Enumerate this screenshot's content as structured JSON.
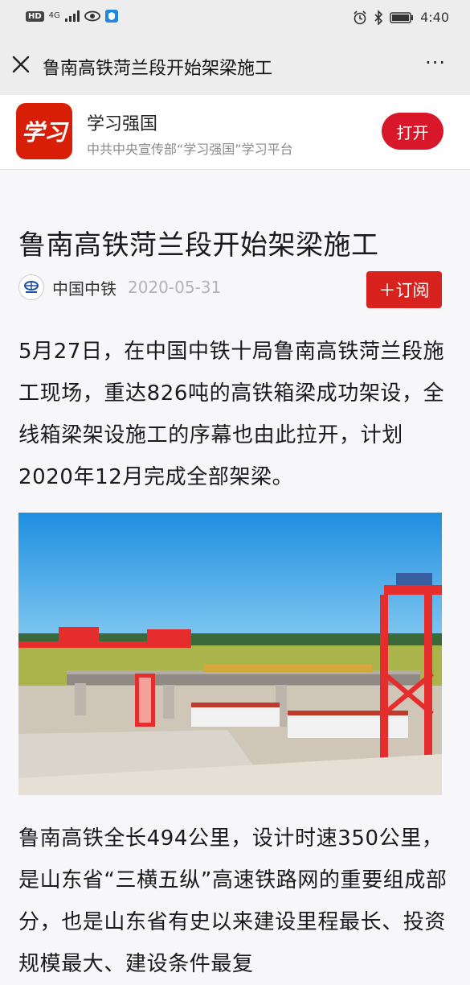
{
  "status_bar": {
    "hd_badge": "HD",
    "network": "4G",
    "time": "4:40",
    "icons": [
      "signal-icon",
      "eye-icon",
      "shield-icon",
      "alarm-icon",
      "bluetooth-icon",
      "battery-icon"
    ]
  },
  "nav": {
    "title": "鲁南高铁菏兰段开始架梁施工",
    "more": "···"
  },
  "app_banner": {
    "logo_text": "学习",
    "name": "学习强国",
    "description": "中共中央宣传部“学习强国”学习平台",
    "open_label": "打开",
    "accent": "#d8182a"
  },
  "article": {
    "title": "鲁南高铁菏兰段开始架梁施工",
    "source": "中国中铁",
    "date": "2020-05-31",
    "subscribe_label": "＋订阅",
    "paragraph1": "5月27日，在中国中铁十局鲁南高铁菏兰段施工现场，重达826吨的高铁箱梁成功架设，全线箱梁架设施工的序幕也由此拉开，计划2020年12月完成全部架梁。",
    "paragraph2": "鲁南高铁全长494公里，设计时速350公里，是山东省“三横五纵”高速铁路网的重要组成部分，也是山东省有史以来建设里程最长、投资规模最大、建设条件最复"
  }
}
